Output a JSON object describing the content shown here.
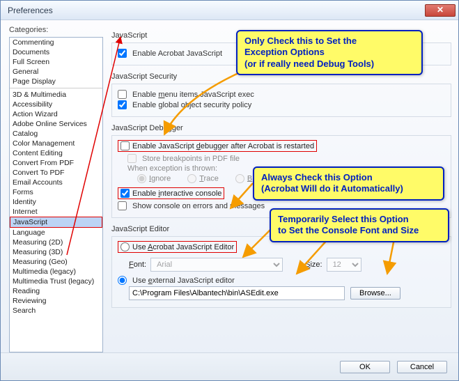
{
  "window": {
    "title": "Preferences"
  },
  "sidebar": {
    "label": "Categories:",
    "groupA": [
      "Commenting",
      "Documents",
      "Full Screen",
      "General",
      "Page Display"
    ],
    "groupB": [
      "3D & Multimedia",
      "Accessibility",
      "Action Wizard",
      "Adobe Online Services",
      "Catalog",
      "Color Management",
      "Content Editing",
      "Convert From PDF",
      "Convert To PDF",
      "Email Accounts",
      "Forms",
      "Identity",
      "Internet",
      "JavaScript",
      "Language",
      "Measuring (2D)",
      "Measuring (3D)",
      "Measuring (Geo)",
      "Multimedia (legacy)",
      "Multimedia Trust (legacy)",
      "Reading",
      "Reviewing",
      "Search"
    ],
    "selectedIndex": 13
  },
  "main": {
    "js": {
      "heading": "JavaScript",
      "enable": "Enable Acrobat JavaScript"
    },
    "sec": {
      "heading": "JavaScript Security",
      "menu_prefix": "Enable ",
      "menu_under": "m",
      "menu_suffix": "enu items JavaScript exec",
      "global_prefix": "Enable ",
      "global_under": "g",
      "global_suffix": "lobal object security policy"
    },
    "dbg": {
      "heading": "JavaScript Debugger",
      "enable_prefix": "Enable JavaScript ",
      "enable_under": "d",
      "enable_suffix": "ebugger after Acrobat is restarted",
      "store": "Store breakpoints in PDF file",
      "when": "When exception is thrown:",
      "opt_ignore_u": "I",
      "opt_ignore_s": "gnore",
      "opt_trace_u": "T",
      "opt_trace_s": "race",
      "opt_break_u": "B",
      "opt_break_s": "reak",
      "interactive_prefix": "Enable ",
      "interactive_under": "i",
      "interactive_suffix": "nteractive console",
      "showconsole": "Show console on errors and messages"
    },
    "editor": {
      "heading": "JavaScript Editor",
      "use_acro_prefix": "Use ",
      "use_acro_under": "A",
      "use_acro_suffix": "crobat JavaScript Editor",
      "font_label_u": "F",
      "font_label_s": "ont:",
      "font_options": [
        "Arial"
      ],
      "size_label_u": "S",
      "size_label_s": "ize:",
      "size_value": "12",
      "use_ext_prefix": "Use ",
      "use_ext_under": "e",
      "use_ext_suffix": "xternal JavaScript editor",
      "path": "C:\\Program Files\\Albantech\\bin\\ASEdit.exe",
      "browse": "Browse..."
    }
  },
  "footer": {
    "ok": "OK",
    "cancel": "Cancel"
  },
  "callouts": {
    "c1_l1": "Only Check this to Set the",
    "c1_l2": "Exception Options",
    "c1_l3": "(or if really need Debug Tools)",
    "c2_l1": "Always Check this Option",
    "c2_l2": "(Acrobat Will do it Automatically)",
    "c3_l1": "Temporarily Select this Option",
    "c3_l2": "to Set the Console Font and Size"
  }
}
